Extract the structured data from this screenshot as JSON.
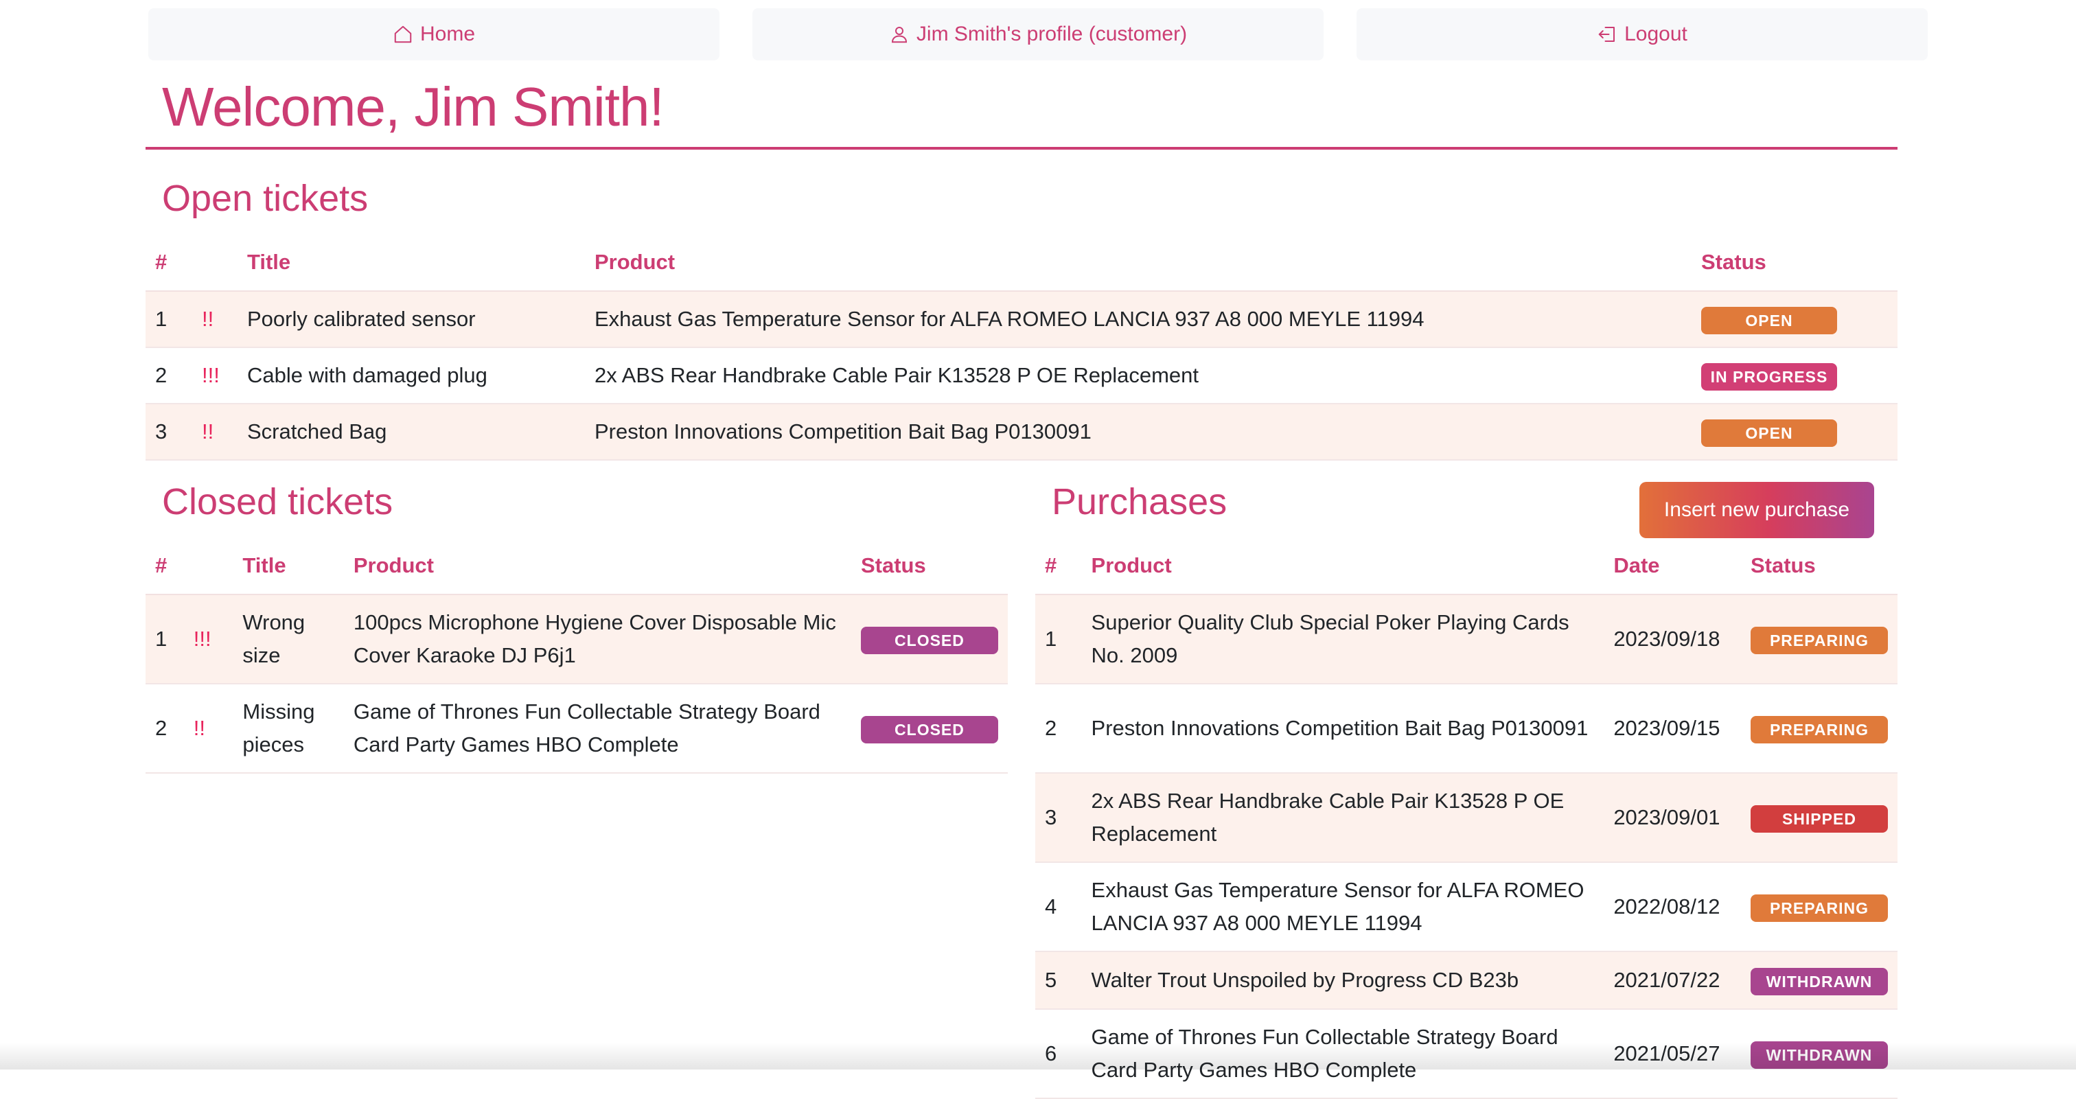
{
  "nav": {
    "home": "Home",
    "profile": "Jim Smith's profile (customer)",
    "logout": "Logout"
  },
  "welcome": "Welcome, Jim Smith!",
  "open_tickets": {
    "title": "Open tickets",
    "headers": [
      "#",
      "Title",
      "Product",
      "Status"
    ],
    "rows": [
      {
        "id": "1",
        "priority": "!!",
        "title": "Poorly calibrated sensor",
        "product": "Exhaust Gas Temperature Sensor for ALFA ROMEO LANCIA 937 A8 000 MEYLE 11994",
        "status": "OPEN"
      },
      {
        "id": "2",
        "priority": "!!!",
        "title": "Cable with damaged plug",
        "product": "2x ABS Rear Handbrake Cable Pair K13528 P OE Replacement",
        "status": "IN PROGRESS"
      },
      {
        "id": "3",
        "priority": "!!",
        "title": "Scratched Bag",
        "product": "Preston Innovations Competition Bait Bag P0130091",
        "status": "OPEN"
      }
    ]
  },
  "closed_tickets": {
    "title": "Closed tickets",
    "headers": [
      "#",
      "Title",
      "Product",
      "Status"
    ],
    "rows": [
      {
        "id": "1",
        "priority": "!!!",
        "title": "Wrong size",
        "product": "100pcs Microphone Hygiene Cover Disposable Mic Cover Karaoke DJ P6j1",
        "status": "CLOSED"
      },
      {
        "id": "2",
        "priority": "!!",
        "title": "Missing pieces",
        "product": "Game of Thrones Fun Collectable Strategy Board Card Party Games HBO Complete",
        "status": "CLOSED"
      }
    ]
  },
  "purchases": {
    "title": "Purchases",
    "insert_label": "Insert new purchase",
    "headers": [
      "#",
      "Product",
      "Date",
      "Status"
    ],
    "rows": [
      {
        "id": "1",
        "product": "Superior Quality Club Special Poker Playing Cards No. 2009",
        "date": "2023/09/18",
        "status": "PREPARING"
      },
      {
        "id": "2",
        "product": "Preston Innovations Competition Bait Bag P0130091",
        "date": "2023/09/15",
        "status": "PREPARING"
      },
      {
        "id": "3",
        "product": "2x ABS Rear Handbrake Cable Pair K13528 P OE Replacement",
        "date": "2023/09/01",
        "status": "SHIPPED"
      },
      {
        "id": "4",
        "product": "Exhaust Gas Temperature Sensor for ALFA ROMEO LANCIA 937 A8 000 MEYLE 11994",
        "date": "2022/08/12",
        "status": "PREPARING"
      },
      {
        "id": "5",
        "product": "Walter Trout Unspoiled by Progress CD B23b",
        "date": "2021/07/22",
        "status": "WITHDRAWN"
      },
      {
        "id": "6",
        "product": "Game of Thrones Fun Collectable Strategy Board Card Party Games HBO Complete",
        "date": "2021/05/27",
        "status": "WITHDRAWN"
      }
    ]
  },
  "colors": {
    "accent": "#cc3d73",
    "open": "#e07a3a",
    "in_progress": "#d23f75",
    "closed": "#a8458f",
    "shipped": "#d23e3e",
    "row_alt": "#fdf1ec"
  }
}
